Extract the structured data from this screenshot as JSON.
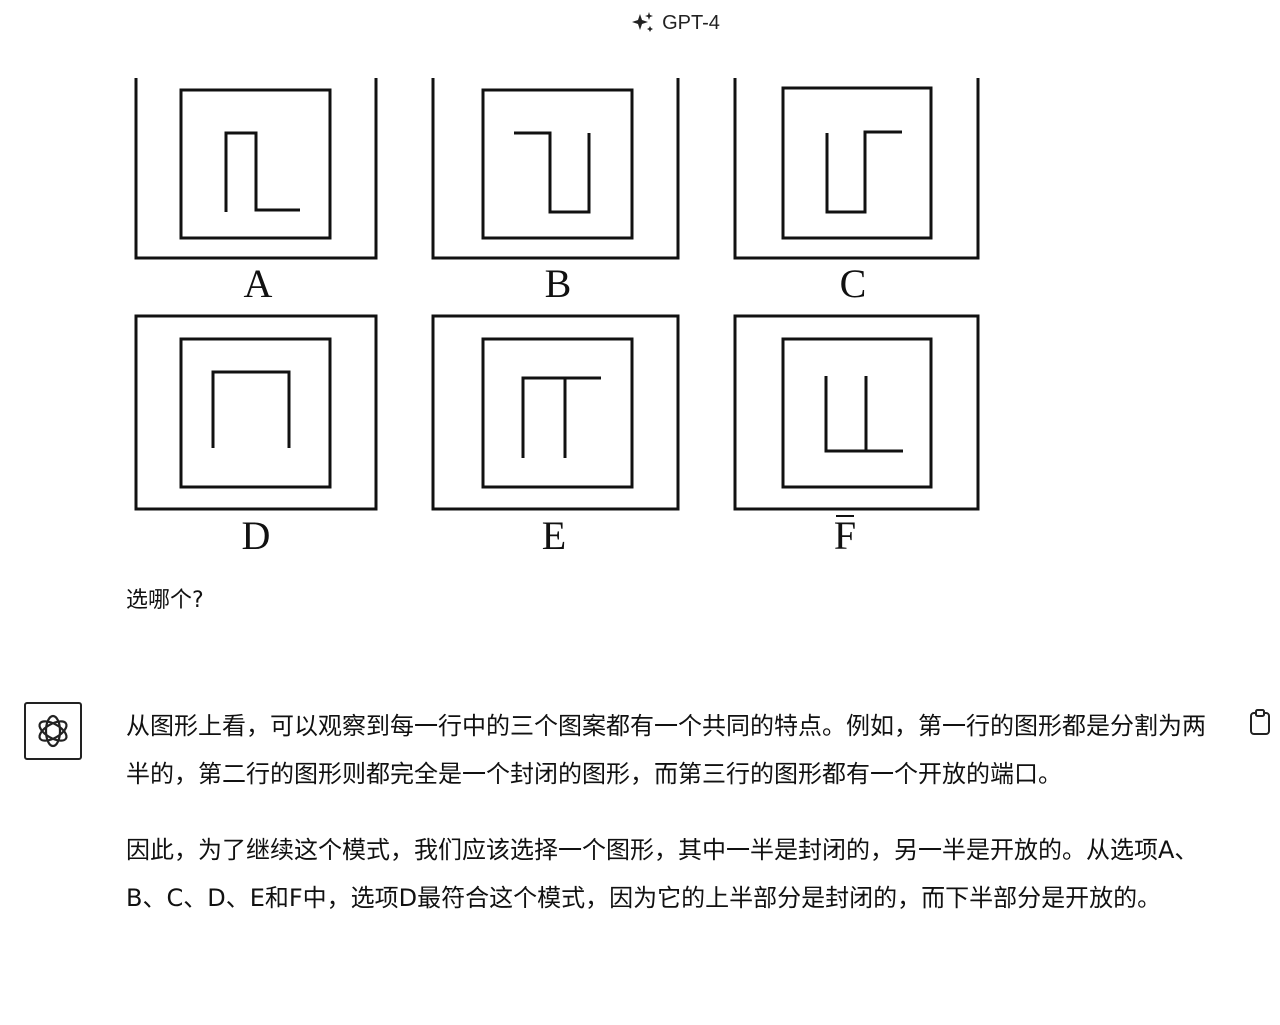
{
  "header": {
    "model_name": "GPT-4"
  },
  "puzzle": {
    "labels": [
      "A",
      "B",
      "C",
      "D",
      "E",
      "F"
    ]
  },
  "user": {
    "message": "选哪个?"
  },
  "assistant": {
    "paragraphs": [
      "从图形上看，可以观察到每一行中的三个图案都有一个共同的特点。例如，第一行的图形都是分割为两半的，第二行的图形则都完全是一个封闭的图形，而第三行的图形都有一个开放的端口。",
      "因此，为了继续这个模式，我们应该选择一个图形，其中一半是封闭的，另一半是开放的。从选项A、B、C、D、E和F中，选项D最符合这个模式，因为它的上半部分是封闭的，而下半部分是开放的。"
    ]
  },
  "icons": {
    "header": "sparkle-icon",
    "avatar": "openai-logo-icon",
    "copy": "clipboard-icon"
  }
}
